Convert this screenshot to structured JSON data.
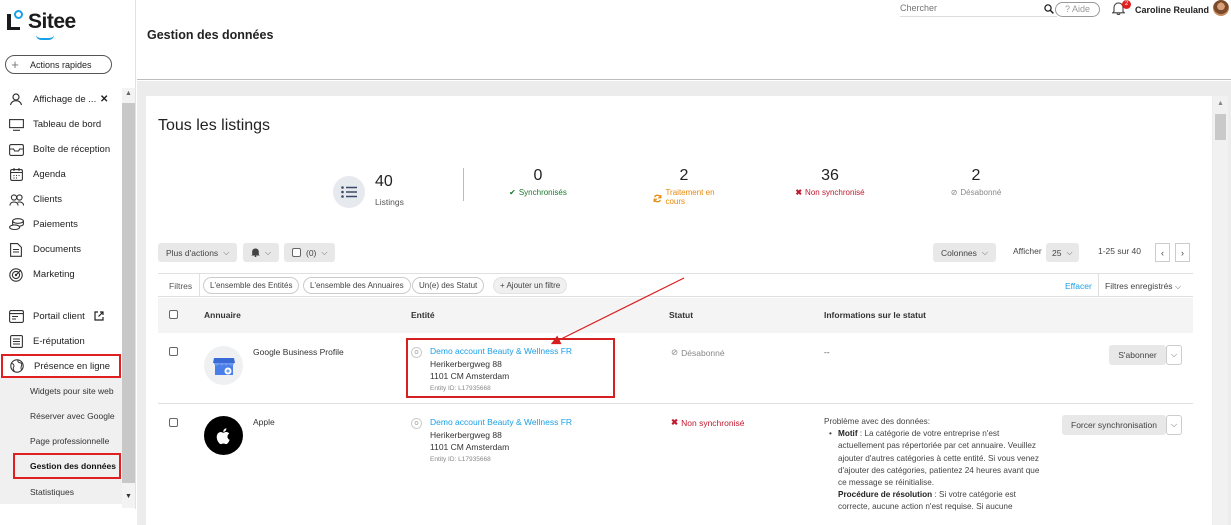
{
  "app": {
    "logo_text": "Sitee"
  },
  "sidebar": {
    "quick_actions": "Actions rapides",
    "items": [
      {
        "label": "Affichage de ...",
        "icon": "users-icon"
      },
      {
        "label": "Tableau de bord",
        "icon": "dashboard-icon"
      },
      {
        "label": "Boîte de réception",
        "icon": "inbox-icon"
      },
      {
        "label": "Agenda",
        "icon": "calendar-icon"
      },
      {
        "label": "Clients",
        "icon": "clients-icon"
      },
      {
        "label": "Paiements",
        "icon": "payments-icon"
      },
      {
        "label": "Documents",
        "icon": "document-icon"
      },
      {
        "label": "Marketing",
        "icon": "target-icon"
      },
      {
        "label": "Portail client",
        "icon": "portal-icon"
      },
      {
        "label": "E-réputation",
        "icon": "list-icon"
      },
      {
        "label": "Présence en ligne",
        "icon": "globe-icon"
      }
    ],
    "sub_items": [
      {
        "label": "Widgets pour site web"
      },
      {
        "label": "Réserver avec Google"
      },
      {
        "label": "Page professionnelle"
      },
      {
        "label": "Gestion des données"
      },
      {
        "label": "Statistiques"
      }
    ]
  },
  "topbar": {
    "search_placeholder": "Chercher",
    "help_label": "? Aide",
    "notif_count": "2",
    "user_name": "Caroline Reuland",
    "page_title": "Gestion des données"
  },
  "main": {
    "title": "Tous les listings",
    "stats": {
      "total": {
        "value": "40",
        "label": "Listings"
      },
      "synced": {
        "value": "0",
        "label": "Synchronisés"
      },
      "processing": {
        "value": "2",
        "label_line1": "Traitement en",
        "label_line2": "cours"
      },
      "not_synced": {
        "value": "36",
        "label": "Non synchronisé"
      },
      "unsubscribed": {
        "value": "2",
        "label": "Désabonné"
      }
    },
    "toolbar": {
      "more_actions": "Plus d'actions",
      "select_count": "(0)",
      "columns": "Colonnes",
      "show_label": "Afficher",
      "per_page": "25",
      "range": "1-25 sur 40",
      "prev": "‹",
      "next": "›"
    },
    "filters": {
      "label": "Filtres",
      "chips": [
        "L'ensemble des Entités",
        "L'ensemble des Annuaires",
        "Un(e) des Statut"
      ],
      "add": "+ Ajouter un filtre",
      "clear": "Effacer",
      "saved": "Filtres enregistrés"
    },
    "table": {
      "headers": [
        "Annuaire",
        "Entité",
        "Statut",
        "Informations sur le statut"
      ],
      "rows": [
        {
          "directory": "Google Business Profile",
          "entity_name": "Demo account Beauty & Wellness FR",
          "address1": "Herikerbergweg 88",
          "address2": "1101 CM Amsterdam",
          "entity_id": "Entity ID: L17935668",
          "status": "Désabonné",
          "info": "--",
          "action": "S'abonner"
        },
        {
          "directory": "Apple",
          "entity_name": "Demo account Beauty & Wellness FR",
          "address1": "Herikerbergweg 88",
          "address2": "1101 CM Amsterdam",
          "entity_id": "Entity ID: L17935668",
          "status": "Non synchronisé",
          "info_title": "Problème avec des données:",
          "motif_label": "Motif",
          "motif_text": " : La catégorie de votre entreprise n'est actuellement pas répertoriée par cet annuaire. Veuillez ajouter d'autres catégories à cette entité. Si vous venez d'ajouter des catégories, patientez 24 heures avant que ce message se réinitialise.",
          "procedure_label": "Procédure de résolution",
          "procedure_text": " : Si votre catégorie est correcte, aucune action n'est requise. Si aucune",
          "action": "Forcer synchronisation"
        }
      ]
    }
  },
  "colors": {
    "accent": "#1aa0e8",
    "highlight": "#e02020",
    "synced": "#1b7a2c",
    "processing": "#e8880a",
    "error": "#c0192e"
  }
}
